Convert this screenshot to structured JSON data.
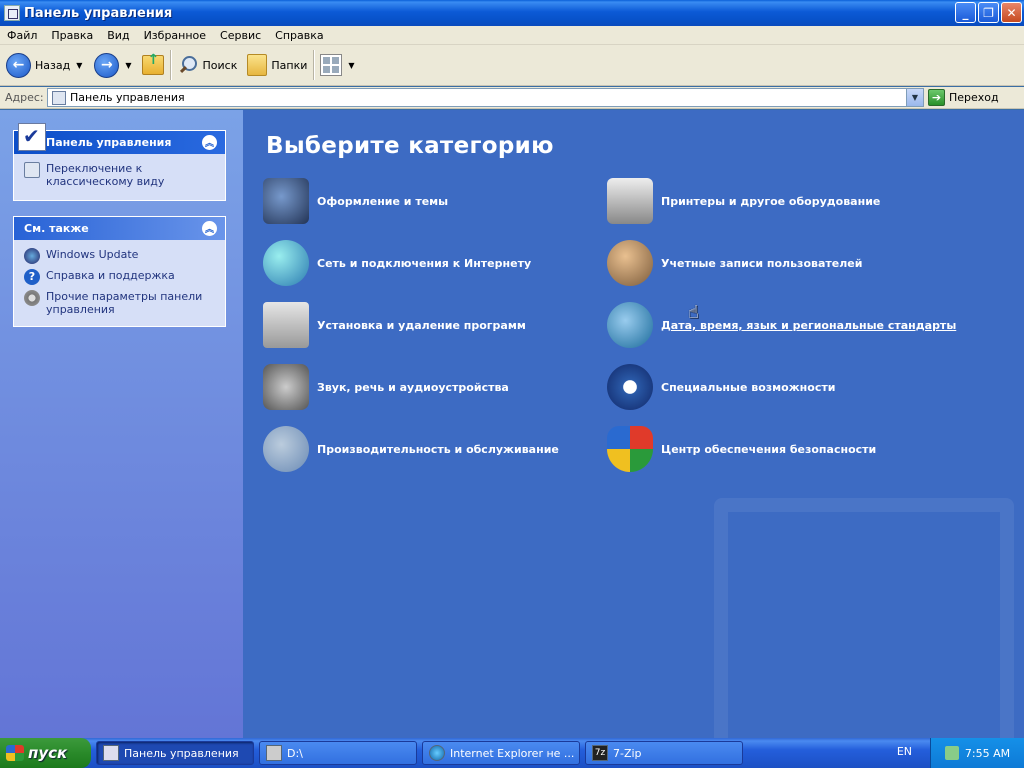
{
  "window": {
    "title": "Панель управления"
  },
  "menu": [
    "Файл",
    "Правка",
    "Вид",
    "Избранное",
    "Сервис",
    "Справка"
  ],
  "toolbar": {
    "back": "Назад",
    "search": "Поиск",
    "folders": "Папки"
  },
  "address": {
    "label": "Адрес:",
    "value": "Панель управления",
    "go": "Переход"
  },
  "sidebar": {
    "control_panel": {
      "title": "Панель управления",
      "items": [
        {
          "label": "Переключение к классическому виду",
          "icon": "classic-view-icon"
        }
      ]
    },
    "see_also": {
      "title": "См. также",
      "items": [
        {
          "label": "Windows Update",
          "icon": "windows-update-icon"
        },
        {
          "label": "Справка и поддержка",
          "icon": "help-icon"
        },
        {
          "label": "Прочие параметры панели управления",
          "icon": "gear-icon"
        }
      ]
    }
  },
  "main": {
    "title": "Выберите категорию",
    "categories": [
      {
        "label": "Оформление и темы",
        "icon": "themes-icon"
      },
      {
        "label": "Принтеры и другое оборудование",
        "icon": "printer-icon"
      },
      {
        "label": "Сеть и подключения к Интернету",
        "icon": "network-icon"
      },
      {
        "label": "Учетные записи пользователей",
        "icon": "users-icon"
      },
      {
        "label": "Установка и удаление программ",
        "icon": "programs-icon"
      },
      {
        "label": "Дата, время, язык и региональные стандарты",
        "icon": "datetime-icon"
      },
      {
        "label": "Звук, речь и аудиоустройства",
        "icon": "sound-icon"
      },
      {
        "label": "Специальные возможности",
        "icon": "accessibility-icon"
      },
      {
        "label": "Производительность и обслуживание",
        "icon": "performance-icon"
      },
      {
        "label": "Центр обеспечения безопасности",
        "icon": "security-icon"
      }
    ]
  },
  "taskbar": {
    "start": "пуск",
    "tasks": [
      {
        "label": "Панель управления",
        "active": true
      },
      {
        "label": "D:\\",
        "active": false
      },
      {
        "label": "Internet Explorer не ...",
        "active": false
      },
      {
        "label": "7-Zip",
        "active": false
      }
    ],
    "lang": "EN",
    "clock": "7:55 AM"
  }
}
